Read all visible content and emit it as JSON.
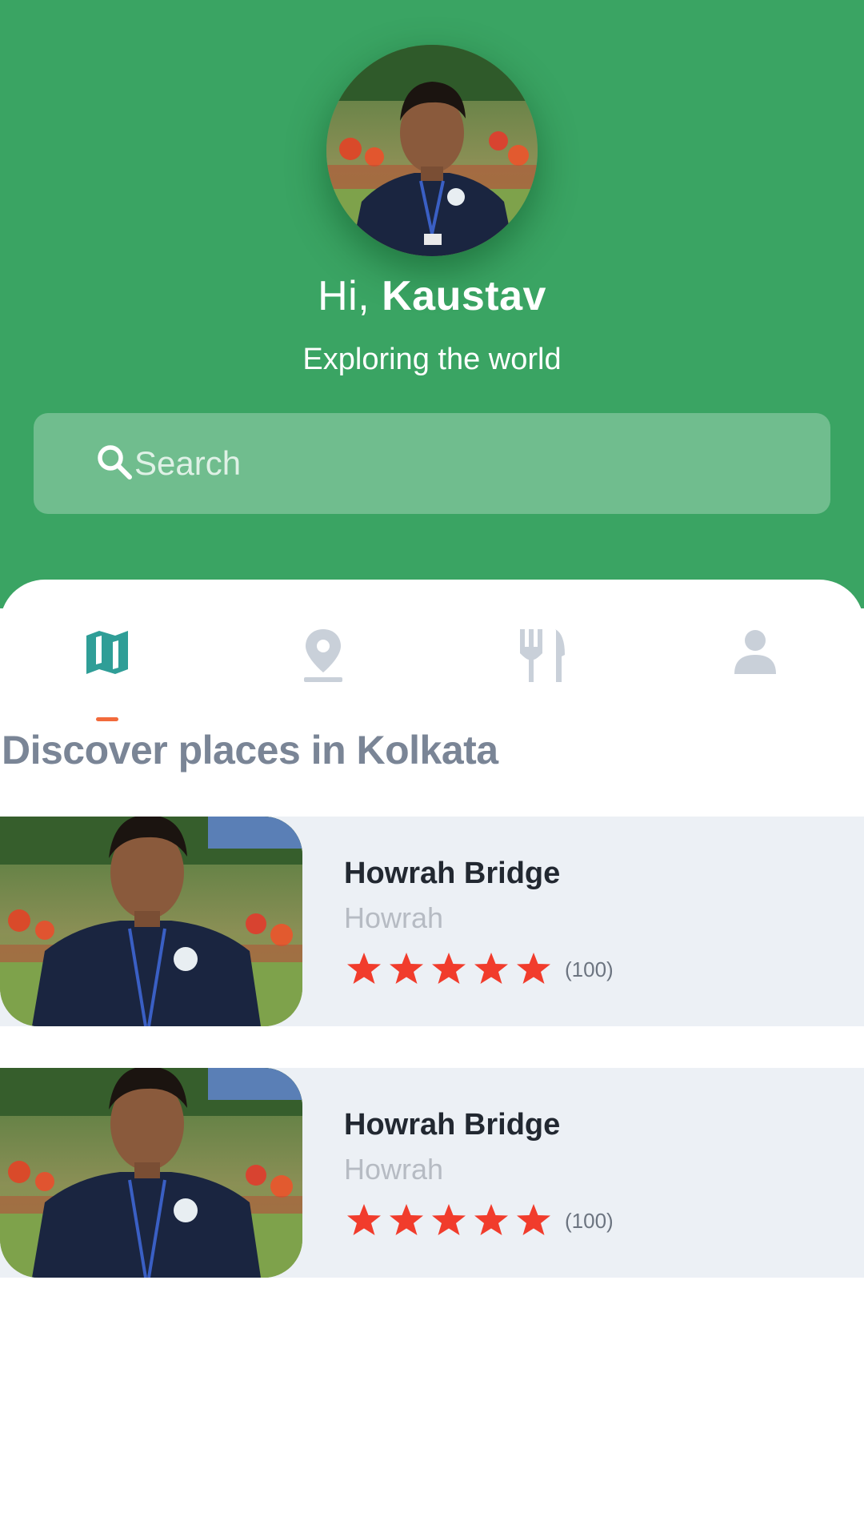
{
  "profile": {
    "greeting_prefix": "Hi, ",
    "name": "Kaustav",
    "tagline": "Exploring the world"
  },
  "search": {
    "placeholder": "Search",
    "icon": "search-icon"
  },
  "tabs": [
    {
      "id": "map",
      "icon": "map-icon",
      "active": true
    },
    {
      "id": "place",
      "icon": "location-pin-icon",
      "active": false
    },
    {
      "id": "food",
      "icon": "fork-knife-icon",
      "active": false
    },
    {
      "id": "profile",
      "icon": "person-icon",
      "active": false
    }
  ],
  "section": {
    "title": "Discover places in Kolkata"
  },
  "places": [
    {
      "name": "Howrah Bridge",
      "location": "Howrah",
      "rating": 5,
      "reviews": "(100)"
    },
    {
      "name": "Howrah Bridge",
      "location": "Howrah",
      "rating": 5,
      "reviews": "(100)"
    }
  ],
  "colors": {
    "header_green": "#3aa463",
    "active_tab": "#2f9e97",
    "inactive_tab": "#c9d0d9",
    "tab_indicator": "#f26a3b",
    "star": "#f13c2c",
    "card_bg": "#ecf0f5"
  }
}
